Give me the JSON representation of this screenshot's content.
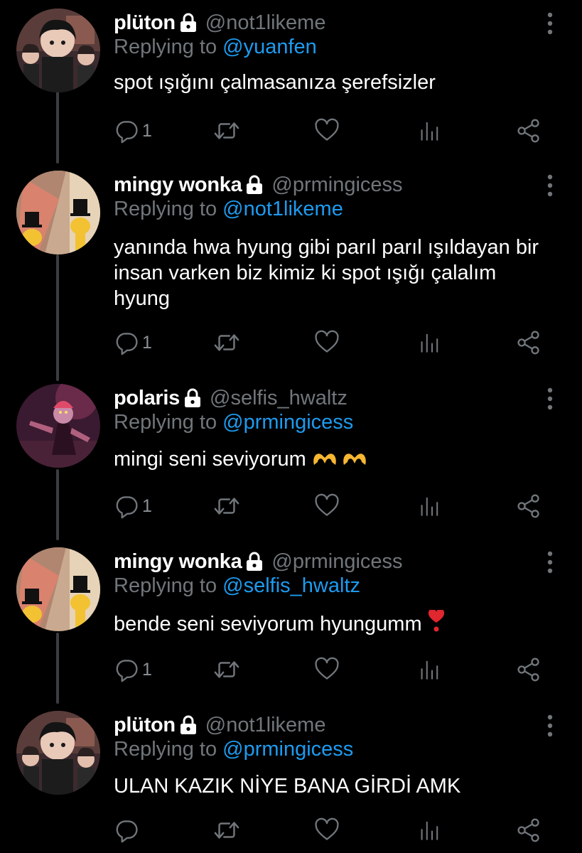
{
  "colors": {
    "background": "#000000",
    "text_primary": "#ffffff",
    "text_secondary": "#71767b",
    "mention": "#1d9bf0",
    "thread_line": "#3a3d42"
  },
  "tweets": [
    {
      "display_name": "plüton",
      "handle": "@not1likeme",
      "replying_prefix": "Replying to",
      "replying_to": "@yuanfen",
      "text": "spot ışığını çalmasanıza şerefsizler",
      "reply_count": "1",
      "avatar": "pluton-avatar"
    },
    {
      "display_name": "mingy wonka",
      "handle": "@prmingicess",
      "replying_prefix": "Replying to",
      "replying_to": "@not1likeme",
      "text": "yanında hwa hyung gibi parıl parıl ışıldayan bir insan varken biz kimiz ki spot ışığı çalalım hyung",
      "reply_count": "1",
      "avatar": "mingy-avatar"
    },
    {
      "display_name": "polaris",
      "handle": "@selfis_hwaltz",
      "replying_prefix": "Replying to",
      "replying_to": "@prmingicess",
      "text": "mingi seni seviyorum",
      "emoji": "heart-hands-emoji x2",
      "reply_count": "1",
      "avatar": "polaris-avatar"
    },
    {
      "display_name": "mingy wonka",
      "handle": "@prmingicess",
      "replying_prefix": "Replying to",
      "replying_to": "@selfis_hwaltz",
      "text": "bende seni seviyorum hyungumm",
      "emoji": "heart-exclamation-emoji",
      "reply_count": "1",
      "avatar": "mingy-avatar"
    },
    {
      "display_name": "plüton",
      "handle": "@not1likeme",
      "replying_prefix": "Replying to",
      "replying_to": "@prmingicess",
      "text": "ULAN KAZIK NİYE BANA GİRDİ AMK",
      "reply_count": "",
      "avatar": "pluton-avatar"
    }
  ],
  "action_icons": [
    "reply-icon",
    "retweet-icon",
    "like-icon",
    "views-icon",
    "share-icon"
  ]
}
